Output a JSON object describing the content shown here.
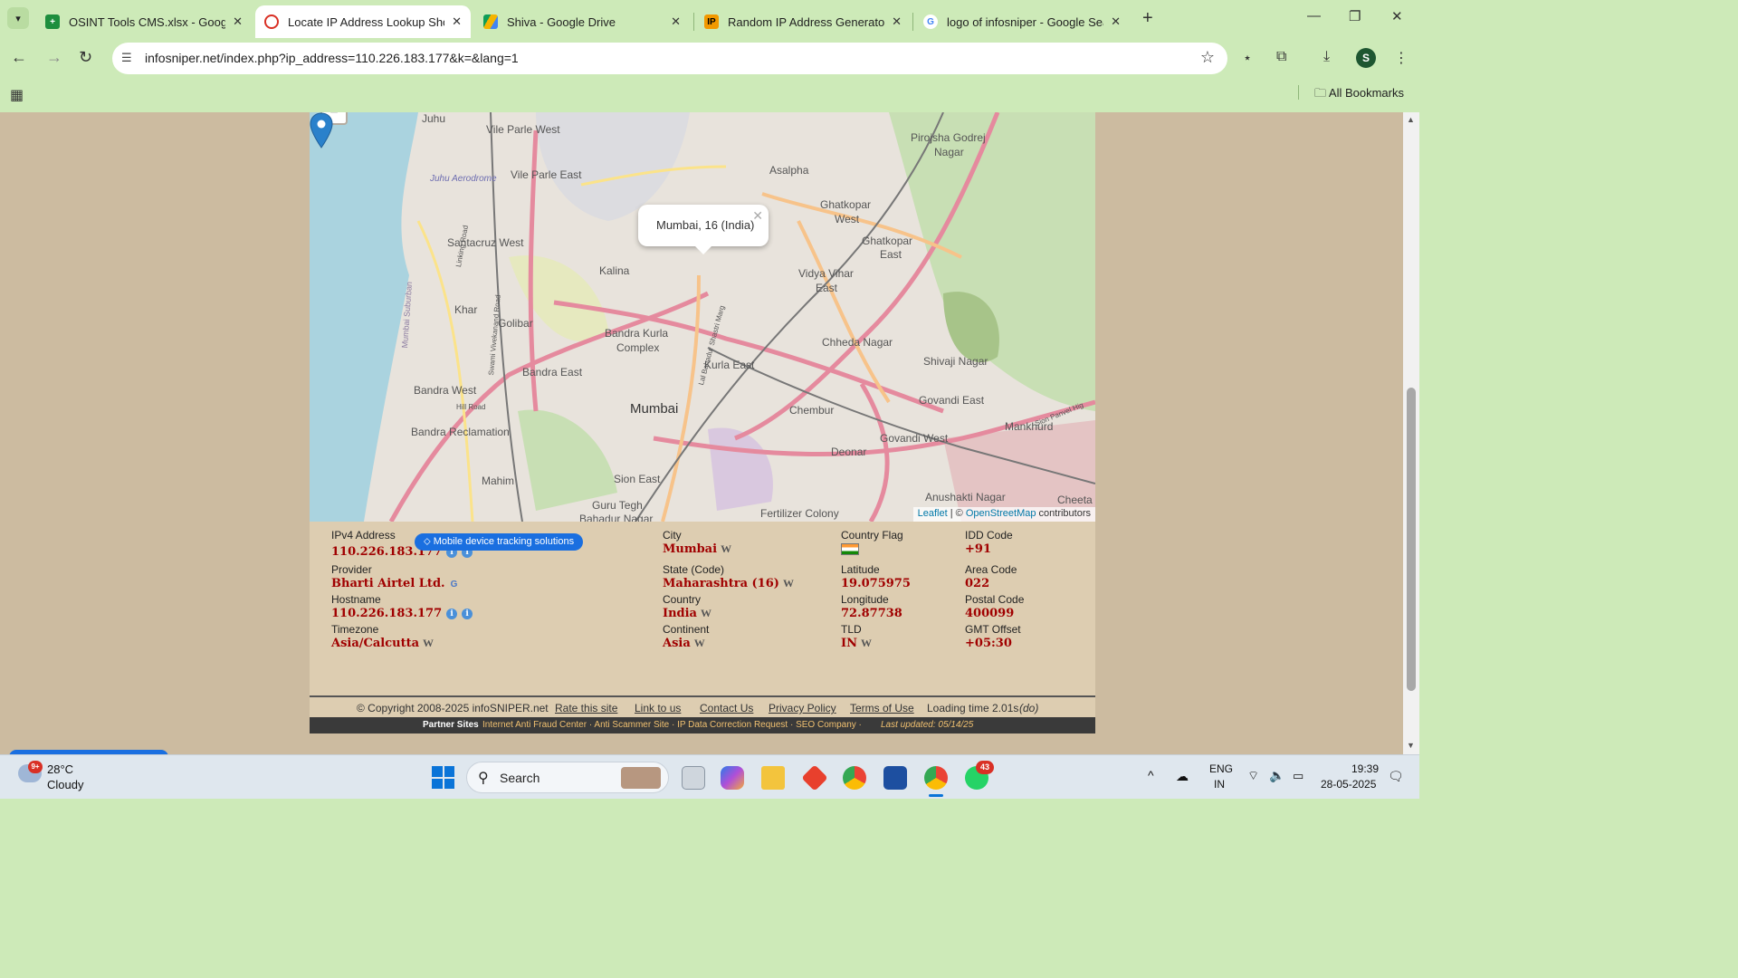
{
  "browser": {
    "tabs": [
      {
        "title": "OSINT Tools CMS.xlsx - Google",
        "icon": "sheets-icon",
        "color": "#1e8e3e"
      },
      {
        "title": "Locate IP Address Lookup Show",
        "icon": "infosniper-icon",
        "color": "#d93025"
      },
      {
        "title": "Shiva - Google Drive",
        "icon": "drive-icon",
        "color": "#f4b400"
      },
      {
        "title": "Random IP Address Generator,",
        "icon": "ip-icon",
        "color": "#f29900"
      },
      {
        "title": "logo of infosniper - Google Sea",
        "icon": "google-icon",
        "color": "#4285f4"
      }
    ],
    "url": "infosniper.net/index.php?ip_address=110.226.183.177&k=&lang=1",
    "profile_initial": "S",
    "all_bookmarks": "All Bookmarks"
  },
  "map": {
    "popup_text": "Mumbai, 16 (India)",
    "attribution_leaflet": "Leaflet",
    "attribution_sep": " | © ",
    "attribution_osm": "OpenStreetMap",
    "attribution_suffix": " contributors",
    "labels": {
      "juhu": "Juhu",
      "vile_parle_west": "Vile Parle West",
      "vile_parle_east": "Vile Parle East",
      "juhu_aerodrome": "Juhu Aerodrome",
      "santacruz_west": "Santacruz West",
      "kalina": "Kalina",
      "khar": "Khar",
      "golibar": "Golibar",
      "bandra_kurla": "Bandra Kurla",
      "complex": "Complex",
      "bandra_east": "Bandra East",
      "bandra_west": "Bandra West",
      "bandra_reclamation": "Bandra Reclamation",
      "mumbai": "Mumbai",
      "mahim": "Mahim",
      "sion_east": "Sion East",
      "guru_tegh": "Guru Tegh",
      "bahadur_nagar": "Bahadur Nagar",
      "kurla_east": "Kurla East",
      "chembur": "Chembur",
      "deonar": "Deonar",
      "fertilizer_colony": "Fertilizer Colony",
      "anushakti_nagar": "Anushakti Nagar",
      "cheeta_c": "Cheeta C",
      "govandi_west": "Govandi West",
      "govandi_east": "Govandi East",
      "mankhurd": "Mankhurd",
      "shivaji_nagar": "Shivaji Nagar",
      "chheda_nagar": "Chheda Nagar",
      "vidya_vihar": "Vidya Vihar",
      "east": "East",
      "ghatkopar_west_1": "Ghatkopar",
      "ghatkopar_west_2": "West",
      "ghatkopar_east_1": "Ghatkopar",
      "ghatkopar_east_2": "East",
      "asalpha": "Asalpha",
      "pirojsha_godrej": "Pirojsha Godrej",
      "nagar": "Nagar",
      "hill_road": "Hill Road",
      "linking_road": "Linking Road",
      "mumbai_suburban": "Mumbai Suburban",
      "lbs_marg": "Lal Bahadur Shastri Marg",
      "swami_vivekanand": "Swami Vivekanand Road",
      "sion_panvel": "Sion Panvel Hig"
    }
  },
  "details": {
    "promo": "Mobile device tracking solutions",
    "ipv4_label": "IPv4 Address",
    "ipv4_value": "110.226.183.177",
    "provider_label": "Provider",
    "provider_value": "Bharti Airtel Ltd.",
    "hostname_label": "Hostname",
    "hostname_value": "110.226.183.177",
    "timezone_label": "Timezone",
    "timezone_value": "Asia/Calcutta",
    "city_label": "City",
    "city_value": "Mumbai",
    "state_label": "State (Code)",
    "state_value": "Maharashtra (16)",
    "country_label": "Country",
    "country_value": "India",
    "continent_label": "Continent",
    "continent_value": "Asia",
    "flag_label": "Country Flag",
    "latitude_label": "Latitude",
    "latitude_value": "19.075975",
    "longitude_label": "Longitude",
    "longitude_value": "72.87738",
    "tld_label": "TLD",
    "tld_value": "IN",
    "idd_label": "IDD Code",
    "idd_value": "+91",
    "area_label": "Area Code",
    "area_value": "022",
    "postal_label": "Postal Code",
    "postal_value": "400099",
    "gmt_label": "GMT Offset",
    "gmt_value": "+05:30"
  },
  "footer": {
    "copyright": "© Copyright 2008-2025 infoSNIPER.net",
    "rate": "Rate this site",
    "link": "Link to us",
    "contact": "Contact Us",
    "privacy": "Privacy Policy",
    "terms": "Terms of Use",
    "loading": "Loading time 2.01s",
    "loading_suffix": "(do)",
    "partner_label": "Partner Sites",
    "partner_links": "Internet Anti Fraud Center · Anti Scammer Site · IP Data Correction Request · SEO Company ·",
    "last_updated": "Last updated: 05/14/25"
  },
  "taskbar": {
    "weather_badge": "9+",
    "temperature": "28°C",
    "condition": "Cloudy",
    "search": "Search",
    "whatsapp_badge": "43",
    "lang_1": "ENG",
    "lang_2": "IN",
    "time": "19:39",
    "date": "28-05-2025"
  }
}
